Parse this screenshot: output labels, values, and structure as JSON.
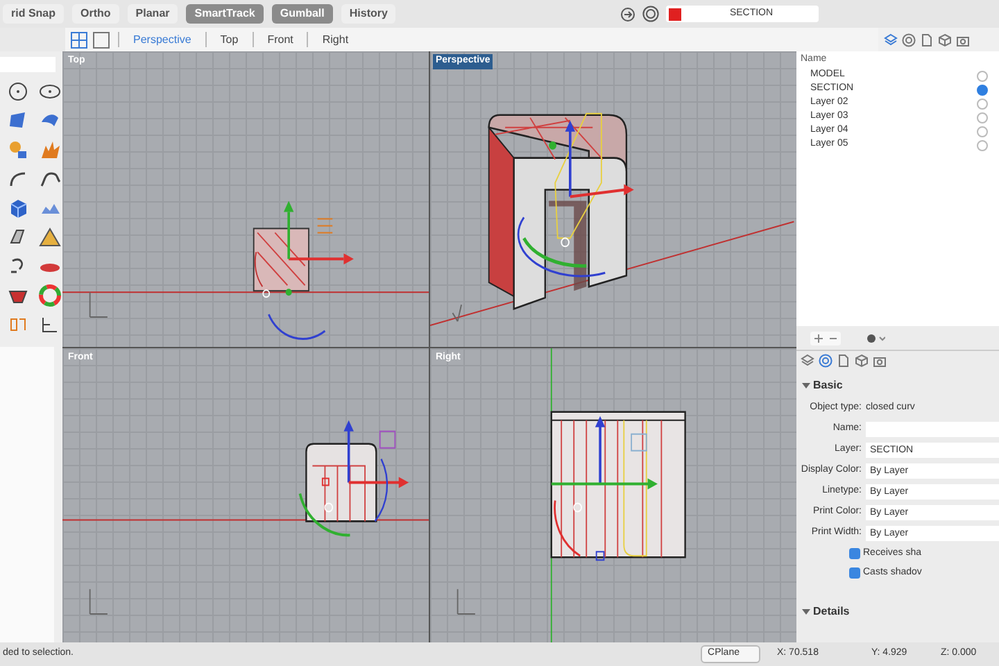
{
  "toolbar": {
    "items": [
      {
        "label": "rid Snap",
        "on": false
      },
      {
        "label": "Ortho",
        "on": false
      },
      {
        "label": "Planar",
        "on": false
      },
      {
        "label": "SmartTrack",
        "on": true
      },
      {
        "label": "Gumball",
        "on": true
      },
      {
        "label": "History",
        "on": false
      }
    ],
    "current_layer": "SECTION"
  },
  "viewport_tabs": [
    {
      "label": "Perspective",
      "selected": true
    },
    {
      "label": "Top",
      "selected": false
    },
    {
      "label": "Front",
      "selected": false
    },
    {
      "label": "Right",
      "selected": false
    }
  ],
  "viewports": [
    {
      "title": "Top",
      "kind": "top",
      "active": false
    },
    {
      "title": "Perspective",
      "kind": "perspective",
      "active": true
    },
    {
      "title": "Front",
      "kind": "front",
      "active": false
    },
    {
      "title": "Right",
      "kind": "right",
      "active": false
    }
  ],
  "layers": {
    "header": "Name",
    "items": [
      {
        "name": "MODEL",
        "selected": false
      },
      {
        "name": "SECTION",
        "selected": true
      },
      {
        "name": "Layer 02",
        "selected": false
      },
      {
        "name": "Layer 03",
        "selected": false
      },
      {
        "name": "Layer 04",
        "selected": false
      },
      {
        "name": "Layer 05",
        "selected": false
      }
    ]
  },
  "properties": {
    "section": "Basic",
    "fields": [
      {
        "label": "Object type:",
        "value": "closed curv",
        "kind": "text"
      },
      {
        "label": "Name:",
        "kind": "input"
      },
      {
        "label": "Layer:",
        "value": "SECTION",
        "kind": "select"
      },
      {
        "label": "Display Color:",
        "value": "By Layer",
        "kind": "select"
      },
      {
        "label": "Linetype:",
        "value": "By Layer",
        "kind": "select"
      },
      {
        "label": "Print Color:",
        "value": "By Layer",
        "kind": "select"
      },
      {
        "label": "Print Width:",
        "value": "By Layer",
        "kind": "select"
      }
    ],
    "checks": [
      {
        "label": "Receives sha",
        "checked": true
      },
      {
        "label": "Casts shadov",
        "checked": true
      }
    ],
    "details": "Details"
  },
  "status_bar": {
    "message": "ded to selection.",
    "cplane": "CPlane",
    "x": "X: 70.518",
    "y": "Y: 4.929",
    "z": "Z: 0.000"
  }
}
